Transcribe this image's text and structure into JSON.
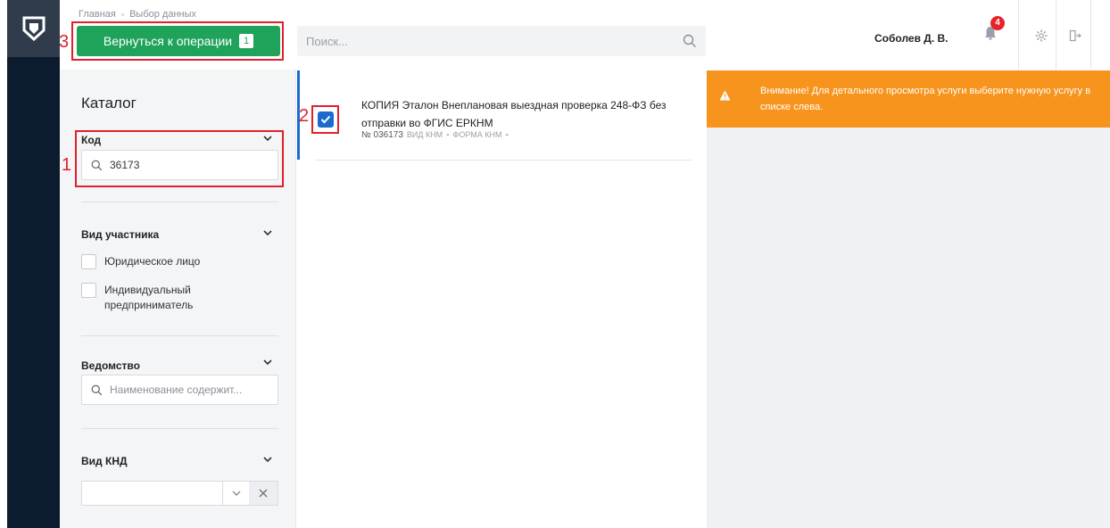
{
  "breadcrumb": {
    "home": "Главная",
    "current": "Выбор данных"
  },
  "back_button": {
    "label": "Вернуться к операции",
    "count": "1"
  },
  "search": {
    "placeholder": "Поиск..."
  },
  "user": {
    "name": "Соболев Д. В."
  },
  "notifications": {
    "count": "4"
  },
  "catalog": {
    "title": "Каталог",
    "code": {
      "title": "Код",
      "value": "36173"
    },
    "participant": {
      "title": "Вид участника",
      "options": [
        "Юридическое лицо",
        "Индивидуальный предприниматель"
      ]
    },
    "department": {
      "title": "Ведомство",
      "placeholder": "Наименование содержит..."
    },
    "knd": {
      "title": "Вид КНД"
    }
  },
  "result": {
    "title": "КОПИЯ Эталон Внеплановая выездная проверка 248-ФЗ без отправки во ФГИС ЕРКНМ",
    "number": "№ 036173",
    "vid_label": "ВИД КНМ",
    "vid_value": "-",
    "forma_label": "ФОРМА КНМ",
    "forma_value": "-",
    "checked": true
  },
  "warning": {
    "text": "Внимание! Для детального просмотра услуги выберите нужную услугу в списке слева."
  },
  "annotations": {
    "n1": "1",
    "n2": "2",
    "n3": "3"
  },
  "colors": {
    "accent": "#1fa35a",
    "selection": "#1a6ad0",
    "warning": "#f7941d",
    "annotation": "#e0202a",
    "rail": "#0d1b2e"
  }
}
